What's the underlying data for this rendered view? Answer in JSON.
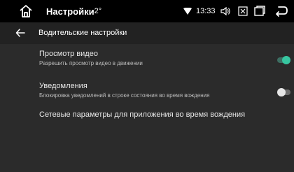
{
  "status_bar": {
    "app_title": "Настройки",
    "temperature": "-2°",
    "time": "13:33",
    "icons": [
      "home-icon",
      "wifi-icon",
      "volume-icon",
      "image-off-icon",
      "recent-apps-icon",
      "back-icon"
    ]
  },
  "header": {
    "title": "Водительские настройки"
  },
  "settings": [
    {
      "title": "Просмотр видео",
      "subtitle": "Разрешить просмотр видео в движении",
      "toggle": "on"
    },
    {
      "title": "Уведомления",
      "subtitle": "Блокировка уведомлений в строке состояния во время вождения",
      "toggle": "off"
    },
    {
      "title": "Сетевые параметры для приложения во время вождения"
    }
  ],
  "colors": {
    "accent": "#37c6a0",
    "background": "#2b2b2b",
    "status_bar": "#000000"
  }
}
